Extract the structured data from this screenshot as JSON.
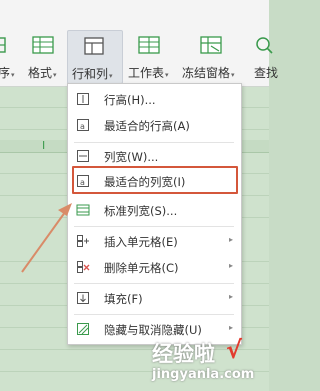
{
  "ribbon": {
    "items": [
      {
        "label": "序",
        "has_dropdown": true
      },
      {
        "label": "格式",
        "has_dropdown": true
      },
      {
        "label": "行和列",
        "has_dropdown": true,
        "active": true
      },
      {
        "label": "工作表",
        "has_dropdown": true
      },
      {
        "label": "冻结窗格",
        "has_dropdown": true
      },
      {
        "label": "查找",
        "has_dropdown": false
      }
    ],
    "dropdown_glyph": "▾"
  },
  "menu": {
    "items": [
      {
        "label": "行高(H)...",
        "icon": "row-height-icon",
        "submenu": false
      },
      {
        "label": "最适合的行高(A)",
        "icon": "best-fit-row-height-icon",
        "submenu": false
      },
      {
        "label": "列宽(W)...",
        "icon": "column-width-icon",
        "submenu": false
      },
      {
        "label": "最适合的列宽(I)",
        "icon": "best-fit-column-width-icon",
        "submenu": false,
        "highlighted": true
      },
      {
        "label": "标准列宽(S)...",
        "icon": "standard-column-width-icon",
        "submenu": false
      },
      {
        "label": "插入单元格(E)",
        "icon": "insert-cells-icon",
        "submenu": true
      },
      {
        "label": "删除单元格(C)",
        "icon": "delete-cells-icon",
        "submenu": true
      },
      {
        "label": "填充(F)",
        "icon": "fill-icon",
        "submenu": true
      },
      {
        "label": "隐藏与取消隐藏(U)",
        "icon": "hide-unhide-icon",
        "submenu": true
      }
    ],
    "submenu_glyph": "▸"
  },
  "sheet": {
    "column_marker": "I"
  },
  "watermark": {
    "brand": "经验啦",
    "check": "√",
    "url": "jingyanla.com"
  },
  "colors": {
    "highlight": "#d4573b",
    "arrow": "#d98b68",
    "sheet_bg": "#cfe2cd",
    "accent_green": "#3a9a4c"
  }
}
